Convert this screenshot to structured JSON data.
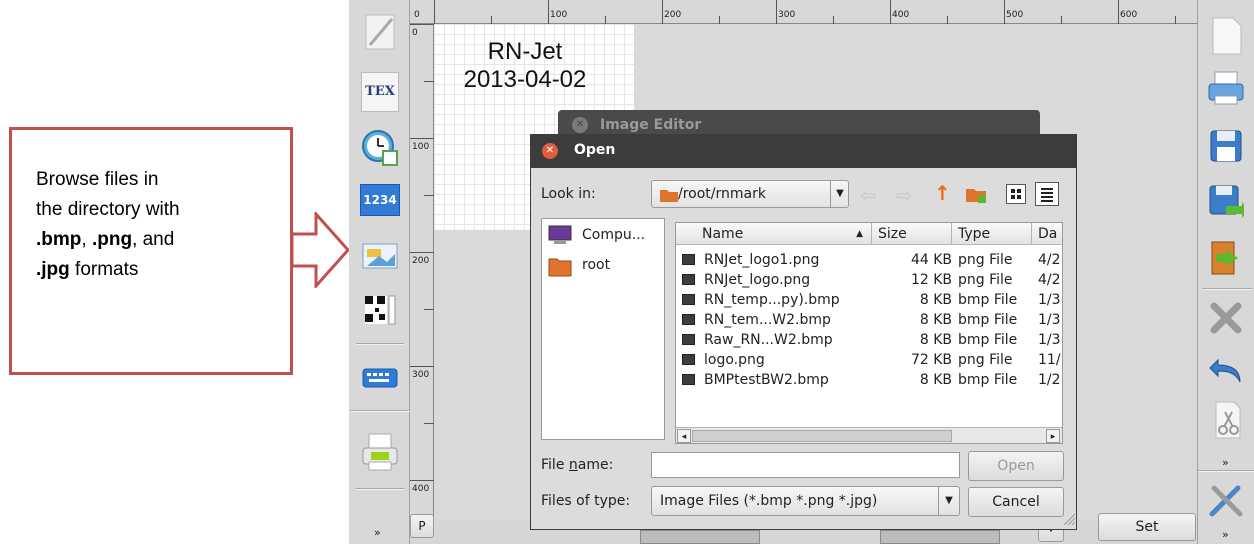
{
  "callout": {
    "line1": "Browse files in",
    "line2": "the directory with",
    "bmp": ".bmp",
    "sep1": ", ",
    "png": ".png",
    "sep2": ", and",
    "jpg": ".jpg",
    "formats": " formats"
  },
  "ruler": {
    "h_labels": [
      "0",
      "100",
      "200",
      "300",
      "400",
      "500",
      "600"
    ],
    "v_labels": [
      "0",
      "100",
      "200",
      "300",
      "400"
    ]
  },
  "canvas": {
    "line1": "RN-Jet",
    "line2": "2013-04-02"
  },
  "left_toolbar": {
    "tex_label": "TEX",
    "counter_label": "1234",
    "p_button": "P"
  },
  "image_editor": {
    "title": "Image Editor"
  },
  "open_dialog": {
    "title": "Open",
    "look_in_label": "Look in:",
    "look_in_value": "/root/rnmark",
    "places": [
      {
        "label": "Compu...",
        "icon": "computer-icon"
      },
      {
        "label": "root",
        "icon": "folder-icon"
      }
    ],
    "columns": [
      "Name",
      "Size",
      "Type",
      "Da"
    ],
    "files": [
      {
        "name": "RNJet_logo1.png",
        "size": "44 KB",
        "type": "png File",
        "date": "4/2"
      },
      {
        "name": "RNJet_logo.png",
        "size": "12 KB",
        "type": "png File",
        "date": "4/2"
      },
      {
        "name": "RN_temp...py).bmp",
        "size": "8 KB",
        "type": "bmp File",
        "date": "1/3"
      },
      {
        "name": "RN_tem...W2.bmp",
        "size": "8 KB",
        "type": "bmp File",
        "date": "1/3"
      },
      {
        "name": "Raw_RN...W2.bmp",
        "size": "8 KB",
        "type": "bmp File",
        "date": "1/3"
      },
      {
        "name": "logo.png",
        "size": "72 KB",
        "type": "png File",
        "date": "11/"
      },
      {
        "name": "BMPtestBW2.bmp",
        "size": "8 KB",
        "type": "bmp File",
        "date": "1/2"
      }
    ],
    "file_name_label_pre": "File ",
    "file_name_label_u": "n",
    "file_name_label_post": "ame:",
    "file_name_value": "",
    "files_of_type_label": "Files of type:",
    "files_of_type_value": "Image Files (*.bmp *.png *.jpg)",
    "open_button": "Open",
    "cancel_button": "Cancel"
  },
  "set_button": "Set",
  "colors": {
    "callout_border": "#c0504d",
    "title_bar": "#3c3c3c",
    "close_button": "#e05f3b"
  }
}
